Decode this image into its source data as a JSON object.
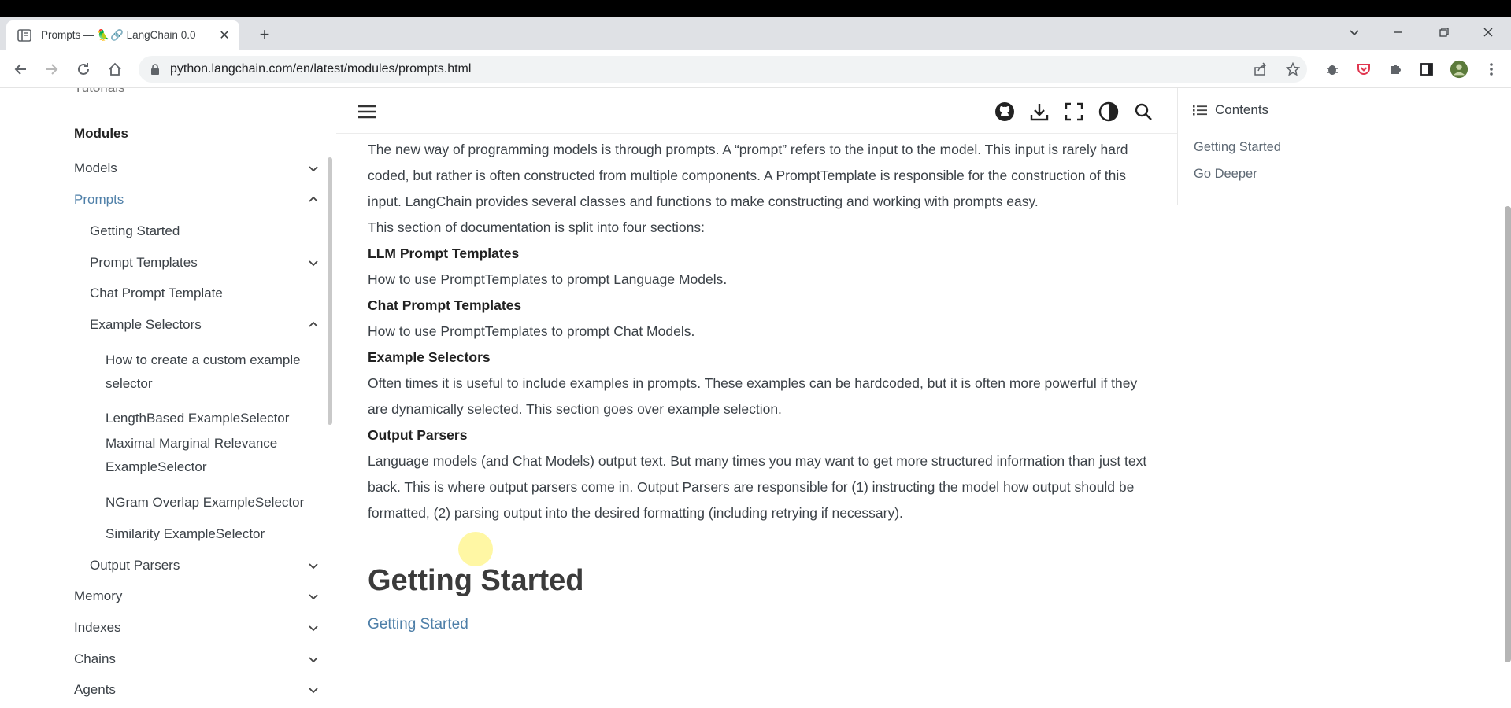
{
  "browser": {
    "tab_title": "Prompts — 🦜🔗 LangChain 0.0",
    "url": "python.langchain.com/en/latest/modules/prompts.html"
  },
  "sidebar": {
    "partial_top": "Tutorials",
    "section_title": "Modules",
    "items": [
      {
        "label": "Models"
      },
      {
        "label": "Prompts"
      },
      {
        "label": "Getting Started"
      },
      {
        "label": "Prompt Templates"
      },
      {
        "label": "Chat Prompt Template"
      },
      {
        "label": "Example Selectors"
      },
      {
        "label": "How to create a custom example",
        "label2": "selector"
      },
      {
        "label": "LengthBased ExampleSelector"
      },
      {
        "label": "Maximal Marginal Relevance",
        "label2": "ExampleSelector"
      },
      {
        "label": "NGram Overlap ExampleSelector"
      },
      {
        "label": "Similarity ExampleSelector"
      },
      {
        "label": "Output Parsers"
      },
      {
        "label": "Memory"
      },
      {
        "label": "Indexes"
      },
      {
        "label": "Chains"
      },
      {
        "label": "Agents"
      }
    ]
  },
  "content": {
    "intro": "The new way of programming models is through prompts. A “prompt” refers to the input to the model. This input is rarely hard coded, but rather is often constructed from multiple components. A PromptTemplate is responsible for the construction of this input. LangChain provides several classes and functions to make constructing and working with prompts easy.",
    "sections_intro": "This section of documentation is split into four sections:",
    "sections": [
      {
        "title": "LLM Prompt Templates",
        "desc": "How to use PromptTemplates to prompt Language Models."
      },
      {
        "title": "Chat Prompt Templates",
        "desc": "How to use PromptTemplates to prompt Chat Models."
      },
      {
        "title": "Example Selectors",
        "desc": "Often times it is useful to include examples in prompts. These examples can be hardcoded, but it is often more powerful if they are dynamically selected. This section goes over example selection."
      },
      {
        "title": "Output Parsers",
        "desc": "Language models (and Chat Models) output text. But many times you may want to get more structured information than just text back. This is where output parsers come in. Output Parsers are responsible for (1) instructing the model how output should be formatted, (2) parsing output into the desired formatting (including retrying if necessary)."
      }
    ],
    "heading": "Getting Started",
    "link": "Getting Started"
  },
  "toc": {
    "title": "Contents",
    "links": [
      "Getting Started",
      "Go Deeper"
    ]
  },
  "colors": {
    "active_link": "#4e7fa8",
    "text": "#3b4147"
  }
}
